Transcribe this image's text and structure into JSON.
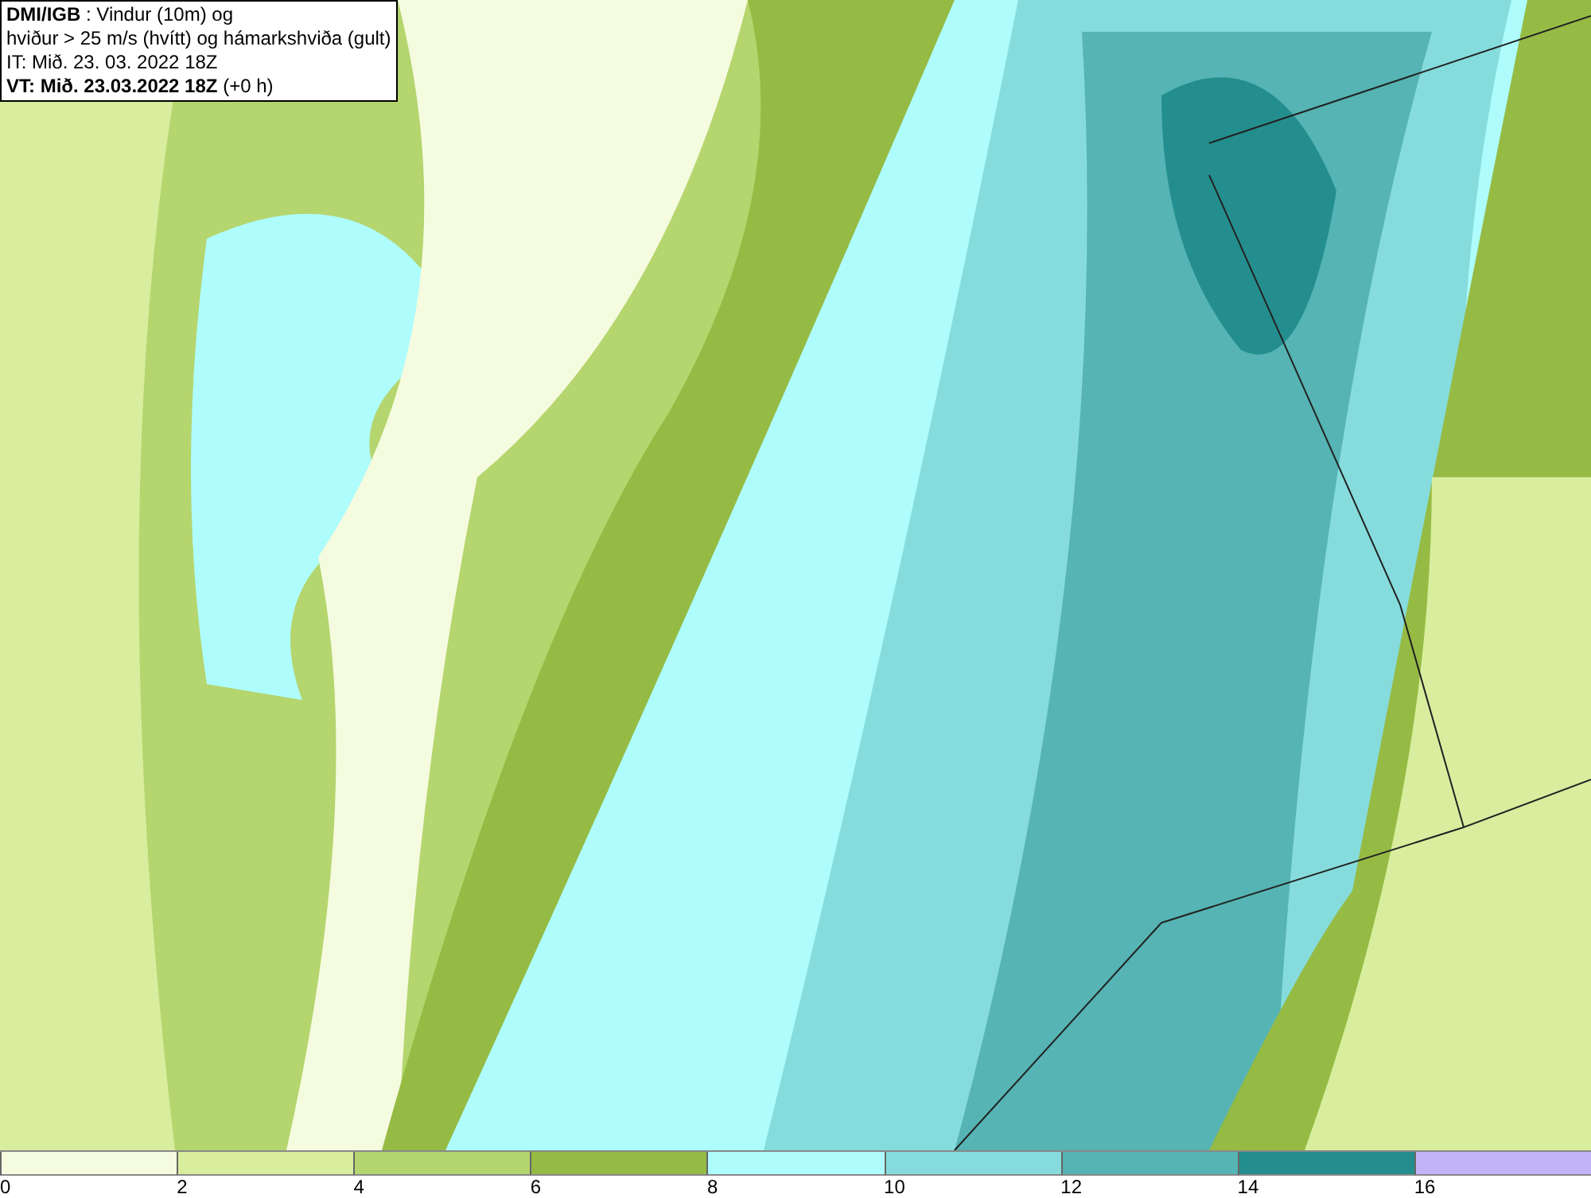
{
  "info_box": {
    "lines": [
      "**DMI/IGB** : Vindur (10m) og",
      "hviður > 25 m/s (hvítt) og hámarkshviða (gult)",
      "IT: Mið. 23. 03. 2022 18Z",
      "**VT: Mið. 23.03.2022 18Z** (+0 h)"
    ]
  },
  "legend": [
    {
      "label": "0",
      "color": "#f5fbdf"
    },
    {
      "label": "2",
      "color": "#d8ee9e"
    },
    {
      "label": "4",
      "color": "#b5d56e"
    },
    {
      "label": "6",
      "color": "#96bb44"
    },
    {
      "label": "8",
      "color": "#aefcfc"
    },
    {
      "label": "10",
      "color": "#86dcdc"
    },
    {
      "label": "12",
      "color": "#56b4b4"
    },
    {
      "label": "14",
      "color": "#248e8e"
    },
    {
      "label": "16",
      "color": "#c2b2f8"
    }
  ]
}
